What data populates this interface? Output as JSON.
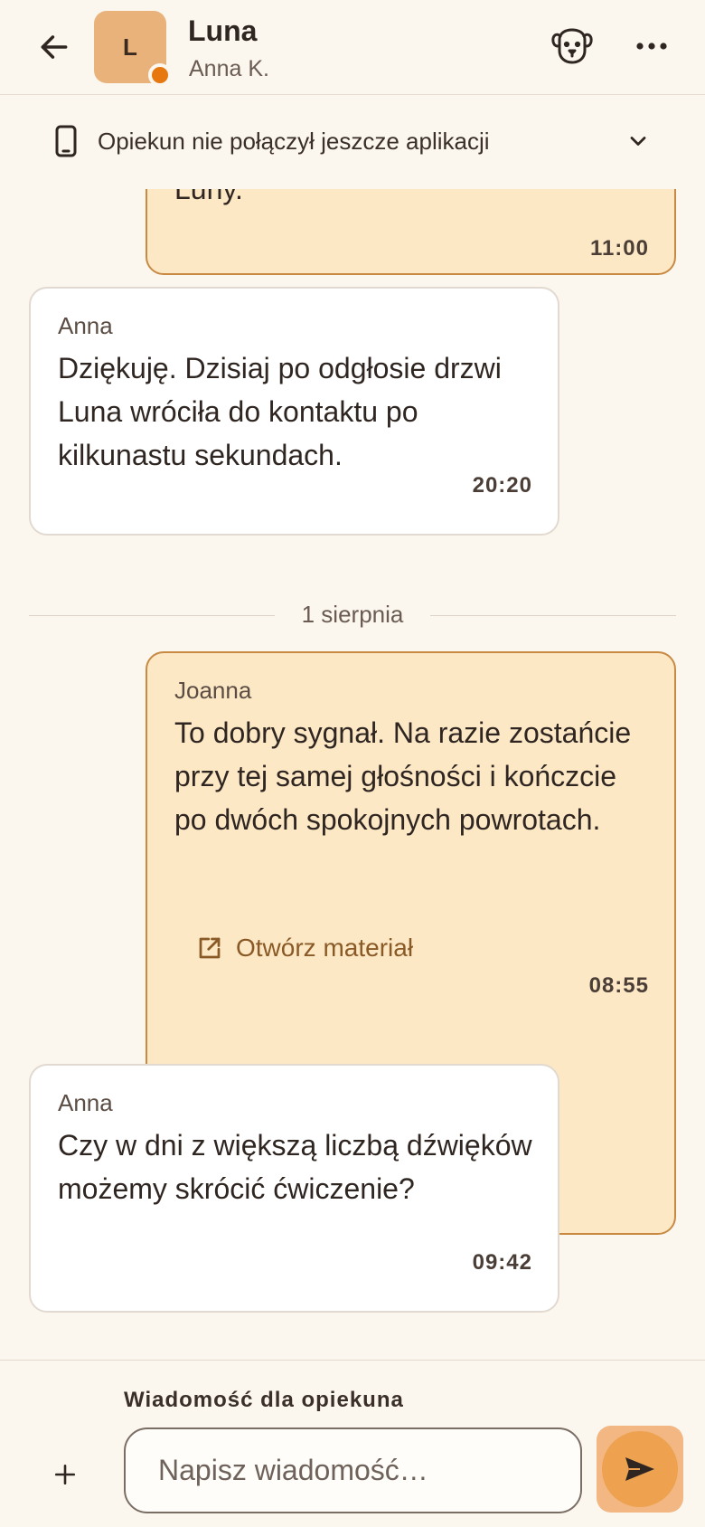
{
  "header": {
    "title": "Luna",
    "subtitle": "Anna K.",
    "avatar_initial": "L",
    "status_color": "#e6780f",
    "icons": [
      "arrow-left-icon",
      "dog-face-icon",
      "more-horizontal-icon"
    ]
  },
  "banner": {
    "text": "Opiekun nie połączył jeszcze aplikacji",
    "icons": [
      "smartphone-icon",
      "chevron-down-icon"
    ]
  },
  "messages": [
    {
      "direction": "out",
      "sender": "",
      "text": "Luny.",
      "time": "11:00"
    },
    {
      "direction": "in",
      "sender": "Anna",
      "text": "Dziękuję. Dzisiaj po odgłosie drzwi Luna wróciła do kontaktu po kilkunastu sekundach.",
      "time": "20:20"
    },
    {
      "direction": "out",
      "sender": "Joanna",
      "text": "To dobry sygnał. Na razie zostańcie przy tej samej głośności i kończcie po dwóch spokojnych powrotach.",
      "attachment_label": "Otwórz materiał",
      "time": "08:55"
    },
    {
      "direction": "in",
      "sender": "Anna",
      "text": "Czy w dni z większą liczbą dźwięków możemy skrócić ćwiczenie?",
      "time": "09:42"
    }
  ],
  "date_separator": "1 sierpnia",
  "composer": {
    "label": "Wiadomość dla opiekuna",
    "placeholder": "Napisz wiadomość…",
    "value": ""
  },
  "colors": {
    "background": "#fbf6ee",
    "outgoing_bubble": "#fde8c6",
    "outgoing_border": "#c88a43",
    "incoming_bubble": "#ffffff",
    "accent": "#eea24f"
  }
}
